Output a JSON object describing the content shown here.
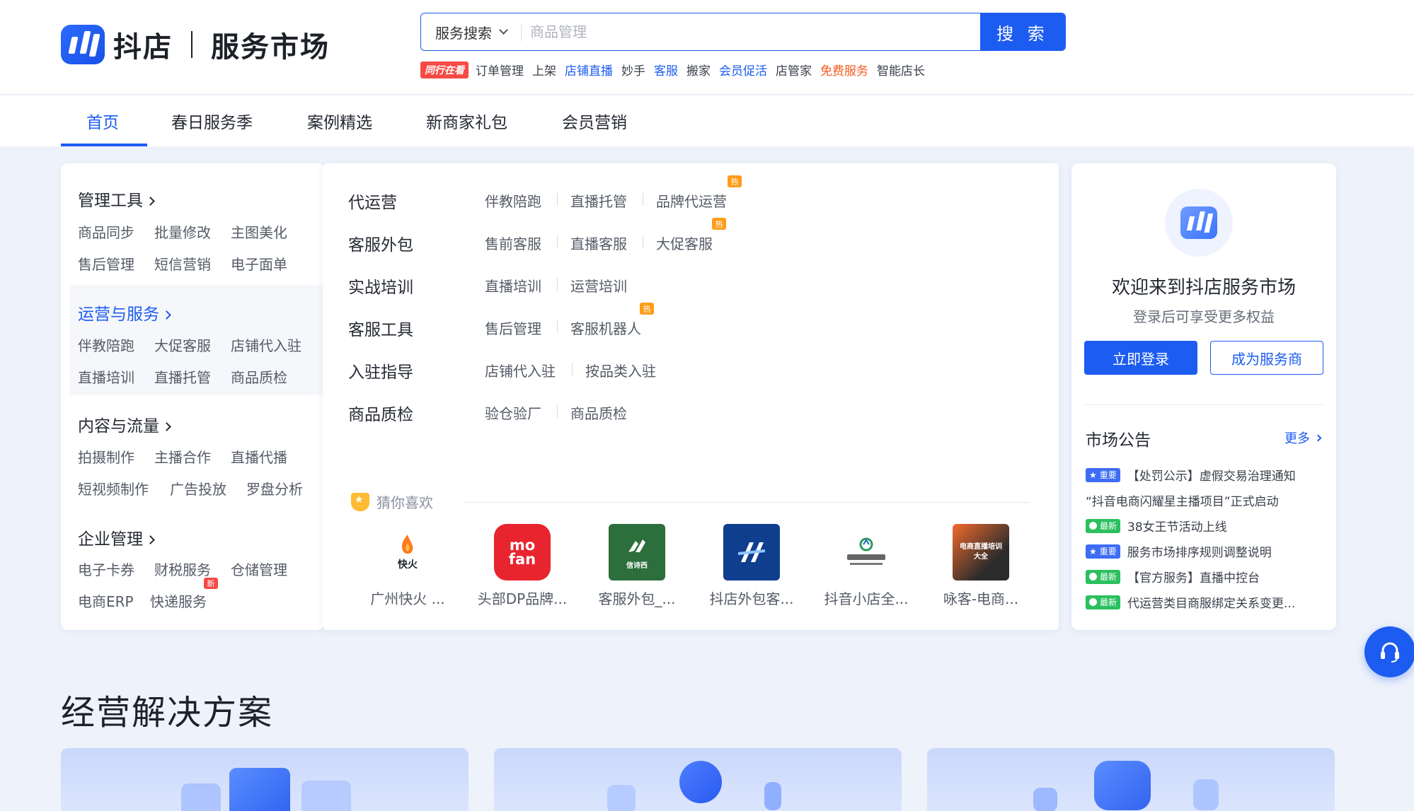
{
  "header": {
    "brand": "抖店",
    "subtitle": "服务市场",
    "search": {
      "scope": "服务搜索",
      "placeholder": "商品管理",
      "button": "搜 索"
    },
    "hot_badge": "同行在看",
    "hotwords": [
      {
        "text": "订单管理",
        "color": "#3a3f4a"
      },
      {
        "text": "上架",
        "color": "#3a3f4a"
      },
      {
        "text": "店铺直播",
        "color": "#1c5cf0"
      },
      {
        "text": "妙手",
        "color": "#3a3f4a"
      },
      {
        "text": "客服",
        "color": "#1c5cf0"
      },
      {
        "text": "搬家",
        "color": "#3a3f4a"
      },
      {
        "text": "会员促活",
        "color": "#1c5cf0"
      },
      {
        "text": "店管家",
        "color": "#3a3f4a"
      },
      {
        "text": "免费服务",
        "color": "#f55a1d"
      },
      {
        "text": "智能店长",
        "color": "#3a3f4a"
      }
    ]
  },
  "nav": {
    "items": [
      "首页",
      "春日服务季",
      "案例精选",
      "新商家礼包",
      "会员营销"
    ],
    "active": 0
  },
  "left_menu": {
    "categories": [
      {
        "title": "管理工具",
        "links": [
          "商品同步",
          "批量修改",
          "主图美化",
          "售后管理",
          "短信营销",
          "电子面单"
        ]
      },
      {
        "title": "运营与服务",
        "links": [
          "伴教陪跑",
          "大促客服",
          "店铺代入驻",
          "直播培训",
          "直播托管",
          "商品质检"
        ]
      },
      {
        "title": "内容与流量",
        "links": [
          "拍摄制作",
          "主播合作",
          "直播代播",
          "短视频制作",
          "广告投放",
          "罗盘分析"
        ]
      },
      {
        "title": "企业管理",
        "links": [
          "电子卡券",
          "财税服务",
          "仓储管理",
          "电商ERP",
          "快递服务"
        ]
      }
    ],
    "active": 1,
    "new_badge": "新"
  },
  "center": {
    "rows": [
      {
        "title": "代运营",
        "links": [
          "伴教陪跑",
          "直播托管",
          "品牌代运营"
        ]
      },
      {
        "title": "客服外包",
        "links": [
          "售前客服",
          "直播客服",
          "大促客服"
        ]
      },
      {
        "title": "实战培训",
        "links": [
          "直播培训",
          "运营培训"
        ]
      },
      {
        "title": "客服工具",
        "links": [
          "售后管理",
          "客服机器人"
        ]
      },
      {
        "title": "入驻指导",
        "links": [
          "店铺代入驻",
          "按品类入驻"
        ]
      },
      {
        "title": "商品质检",
        "links": [
          "验仓验厂",
          "商品质检"
        ]
      }
    ],
    "hot_tag": "热",
    "guess_title": "猜你喜欢",
    "products": [
      {
        "name": "广州快火 ...",
        "logo": "快火"
      },
      {
        "name": "头部DP品牌...",
        "logo": "mo fan"
      },
      {
        "name": "客服外包_...",
        "logo": "信诗西"
      },
      {
        "name": "抖店外包客...",
        "logo": ""
      },
      {
        "name": "抖音小店全...",
        "logo": ""
      },
      {
        "name": "咏客-电商...",
        "logo": "电商直播培训大全"
      }
    ]
  },
  "right_card": {
    "welcome": "欢迎来到抖店服务市场",
    "welcome_sub": "登录后可享受更多权益",
    "login": "立即登录",
    "provider": "成为服务商",
    "notice_title": "市场公告",
    "more": "更多",
    "notices": [
      {
        "tag": "重要",
        "kind": "imp",
        "text": "【处罚公示】虚假交易治理通知"
      },
      {
        "tag": "",
        "kind": "",
        "text": "“抖音电商闪耀星主播项目”正式启动"
      },
      {
        "tag": "最新",
        "kind": "new",
        "text": "38女王节活动上线"
      },
      {
        "tag": "重要",
        "kind": "imp",
        "text": "服务市场排序规则调整说明"
      },
      {
        "tag": "最新",
        "kind": "new",
        "text": "【官方服务】直播中控台"
      },
      {
        "tag": "最新",
        "kind": "new",
        "text": "代运营类目商服绑定关系变更..."
      }
    ]
  },
  "solutions": {
    "title": "经营解决方案"
  },
  "colors": {
    "accent": "#1c5cf0",
    "hot_badge": "#f54a45",
    "hot_tag": "#ff9c1a",
    "new_tag": "#2bc05f"
  }
}
